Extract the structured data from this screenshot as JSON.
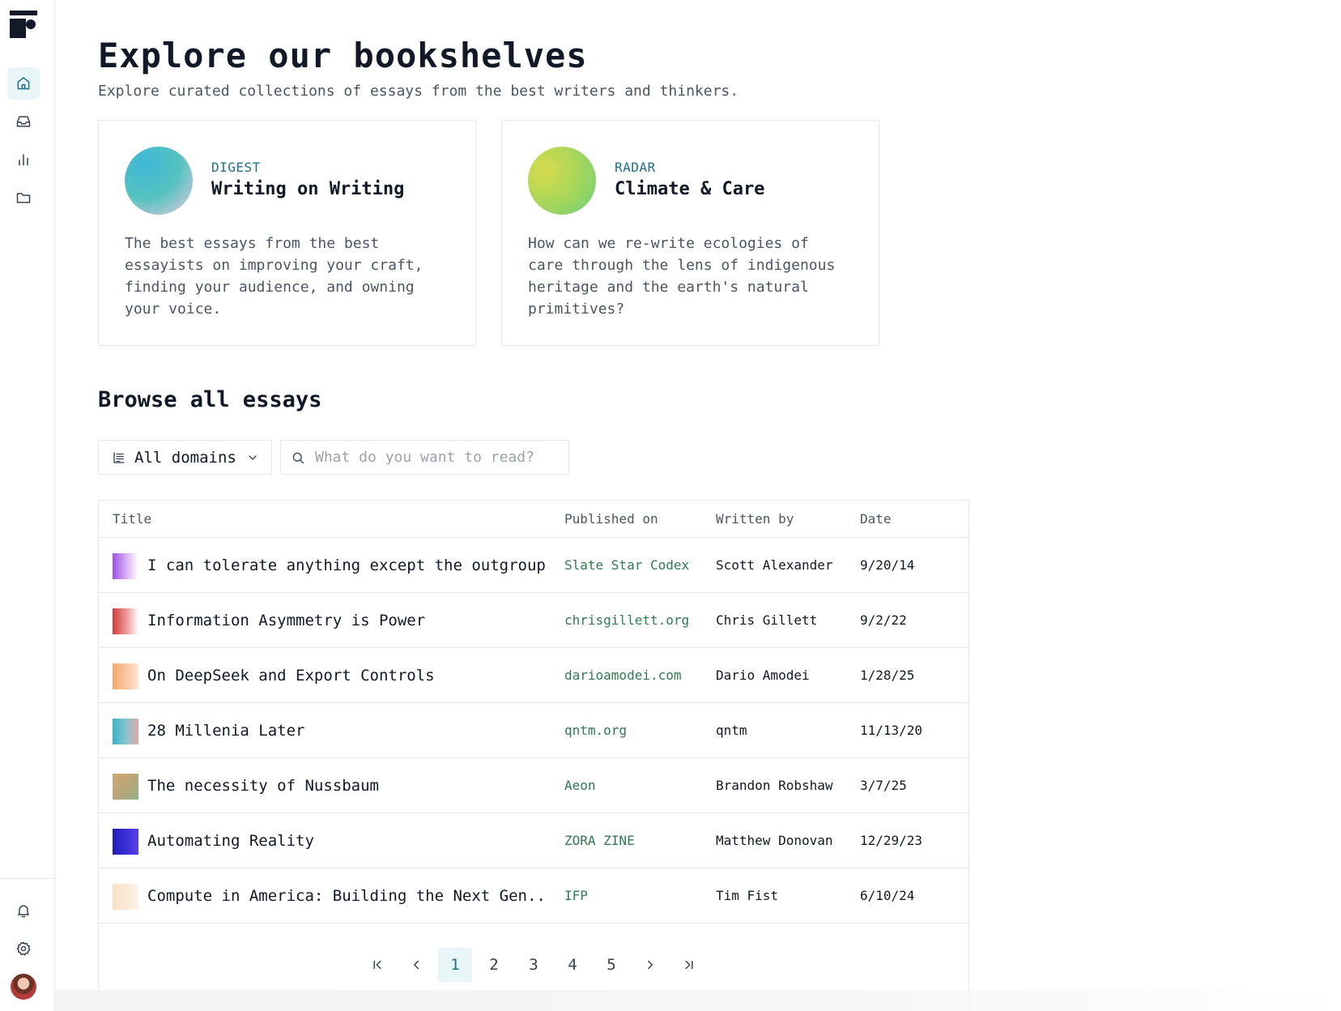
{
  "sidebar": {
    "logo": "publication-logo",
    "nav": [
      {
        "name": "home",
        "icon": "home-icon",
        "active": true
      },
      {
        "name": "inbox",
        "icon": "inbox-icon",
        "active": false
      },
      {
        "name": "stats",
        "icon": "bar-chart-icon",
        "active": false
      },
      {
        "name": "folders",
        "icon": "folder-icon",
        "active": false
      }
    ],
    "bottom": [
      {
        "name": "notifications",
        "icon": "bell-icon"
      },
      {
        "name": "settings",
        "icon": "gear-icon"
      },
      {
        "name": "profile",
        "icon": "avatar"
      }
    ]
  },
  "header": {
    "title": "Explore our bookshelves",
    "subtitle": "Explore curated collections of essays from the best writers and thinkers."
  },
  "collections": [
    {
      "kicker": "DIGEST",
      "title": "Writing on Writing",
      "description": "The best essays from the best essayists on improving your craft, finding your audience, and owning your voice.",
      "gradient": [
        "#3fb8d6",
        "#55c2c0",
        "#e6c9dd"
      ]
    },
    {
      "kicker": "RADAR",
      "title": "Climate & Care",
      "description": "How can we re-write ecologies of care through the lens of indigenous heritage and the earth's natural primitives?",
      "gradient": [
        "#d9db4e",
        "#a7d65a",
        "#6fcf7c"
      ]
    }
  ],
  "browse": {
    "title": "Browse all essays",
    "domain_filter": "All domains",
    "search_placeholder": "What do you want to read?"
  },
  "table": {
    "columns": [
      "Title",
      "Published on",
      "Written by",
      "Date"
    ],
    "rows": [
      {
        "title": "I can tolerate anything except the outgroup",
        "published_on": "Slate Star Codex",
        "author": "Scott Alexander",
        "date": "9/20/14",
        "thumb": [
          "#9b51e0",
          "#d9b3f5",
          "#ffffff"
        ]
      },
      {
        "title": "Information Asymmetry is Power",
        "published_on": "chrisgillett.org",
        "author": "Chris Gillett",
        "date": "9/2/22",
        "thumb": [
          "#d43c3c",
          "#ee9a9a",
          "#ffffff"
        ]
      },
      {
        "title": "On DeepSeek and Export Controls",
        "published_on": "darioamodei.com",
        "author": "Dario Amodei",
        "date": "1/28/25",
        "thumb": [
          "#f5a76c",
          "#f8c9a4",
          "#fde4d2"
        ]
      },
      {
        "title": "28 Millenia Later",
        "published_on": "qntm.org",
        "author": "qntm",
        "date": "11/13/20",
        "thumb": [
          "#34b5c8",
          "#8fc4c9",
          "#e2a8a8"
        ]
      },
      {
        "title": "The necessity of Nussbaum",
        "published_on": "Aeon",
        "author": "Brandon Robshaw",
        "date": "3/7/25",
        "thumb": [
          "#d2a870",
          "#b8a67a",
          "#8fb08b"
        ]
      },
      {
        "title": "Automating Reality",
        "published_on": "ZORA ZINE",
        "author": "Matthew Donovan",
        "date": "12/29/23",
        "thumb": [
          "#1f1fb8",
          "#3b2fd6",
          "#5b3fe6"
        ]
      },
      {
        "title": "Compute in America: Building the Next Gen..",
        "published_on": "IFP",
        "author": "Tim Fist",
        "date": "6/10/24",
        "thumb": [
          "#f9e0c6",
          "#fbe9d7",
          "#fdf3ea"
        ]
      }
    ]
  },
  "pagination": {
    "pages": [
      "1",
      "2",
      "3",
      "4",
      "5"
    ],
    "current": "1",
    "controls": [
      "first-page-icon",
      "prev-page-icon",
      "next-page-icon",
      "last-page-icon"
    ]
  },
  "colors": {
    "accent": "#1f6f8b",
    "accent_bg": "#e8f6f8",
    "publisher_link": "#2f7a50",
    "border": "#e5e7eb"
  }
}
